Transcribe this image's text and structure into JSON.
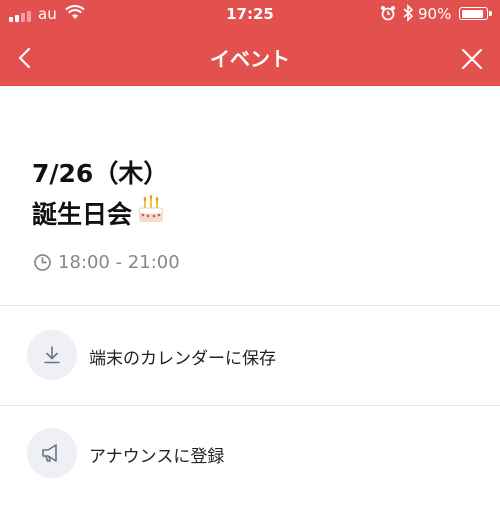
{
  "status_bar": {
    "carrier": "au",
    "time": "17:25",
    "battery_text": "90%",
    "battery_level": 0.9
  },
  "header": {
    "title": "イベント",
    "back_icon": "chevron-left-icon",
    "close_icon": "close-icon",
    "color": "#e3514f"
  },
  "event": {
    "date": "7/26（木）",
    "name": "誕生日会",
    "emoji": "birthday-cake-icon",
    "time": "18:00 - 21:00"
  },
  "actions": [
    {
      "label": "端末のカレンダーに保存",
      "icon": "download-icon"
    },
    {
      "label": "アナウンスに登録",
      "icon": "megaphone-icon"
    }
  ]
}
